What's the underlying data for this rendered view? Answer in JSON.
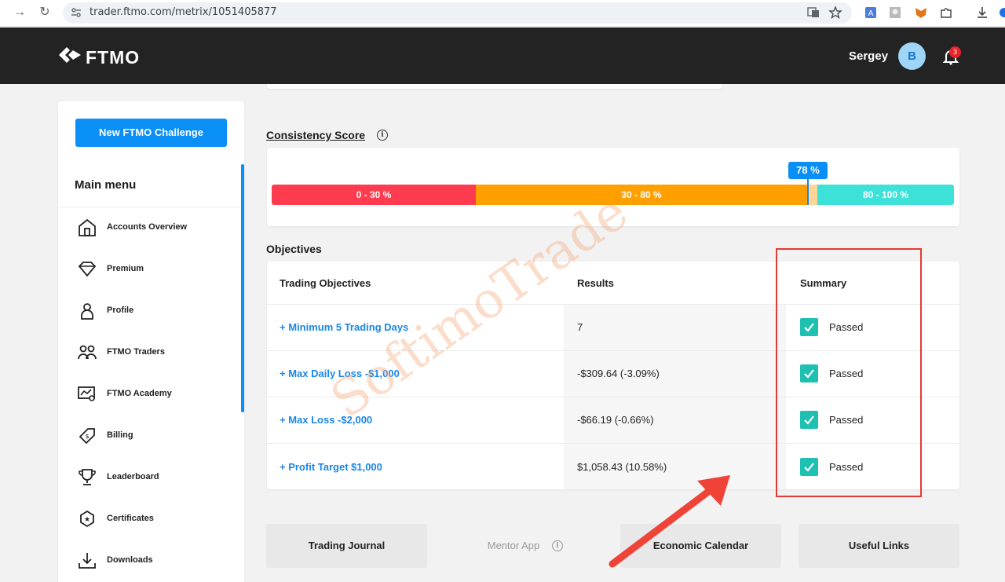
{
  "browser": {
    "url": "trader.ftmo.com/metrix/1051405877"
  },
  "header": {
    "logo_text": "FTMO",
    "user_name": "Sergey",
    "avatar_letter": "B",
    "notification_count": "3"
  },
  "sidebar": {
    "new_challenge_label": "New FTMO Challenge",
    "main_menu_title": "Main menu",
    "items": [
      {
        "label": "Accounts Overview",
        "icon": "home-icon"
      },
      {
        "label": "Premium",
        "icon": "diamond-icon"
      },
      {
        "label": "Profile",
        "icon": "user-icon"
      },
      {
        "label": "FTMO Traders",
        "icon": "users-icon"
      },
      {
        "label": "FTMO Academy",
        "icon": "academy-icon"
      },
      {
        "label": "Billing",
        "icon": "tag-icon"
      },
      {
        "label": "Leaderboard",
        "icon": "trophy-icon"
      },
      {
        "label": "Certificates",
        "icon": "certificate-icon"
      },
      {
        "label": "Downloads",
        "icon": "download-icon"
      }
    ]
  },
  "consistency": {
    "title": "Consistency Score",
    "segments": [
      "0 - 30 %",
      "30 - 80 %",
      "80 - 100 %"
    ],
    "score_label": "78 %",
    "score_value": 78
  },
  "objectives": {
    "title": "Objectives",
    "headers": [
      "Trading Objectives",
      "Results",
      "Summary"
    ],
    "rows": [
      {
        "objective": "+ Minimum 5 Trading Days",
        "result": "7",
        "summary": "Passed"
      },
      {
        "objective": "+ Max Daily Loss -$1,000",
        "result": "-$309.64 (-3.09%)",
        "summary": "Passed"
      },
      {
        "objective": "+ Max Loss -$2,000",
        "result": "-$66.19 (-0.66%)",
        "summary": "Passed"
      },
      {
        "objective": "+ Profit Target $1,000",
        "result": "$1,058.43 (10.58%)",
        "summary": "Passed"
      }
    ]
  },
  "bottom_buttons": [
    "Trading Journal",
    "Mentor App",
    "Economic Calendar",
    "Useful Links"
  ],
  "watermark": "SoftimoTrade",
  "colors": {
    "accent": "#0a8ff6",
    "red": "#ff3b4f",
    "orange": "#ffa000",
    "teal": "#3ee1d8",
    "check": "#1ec0b1",
    "header_bg": "#232323"
  }
}
